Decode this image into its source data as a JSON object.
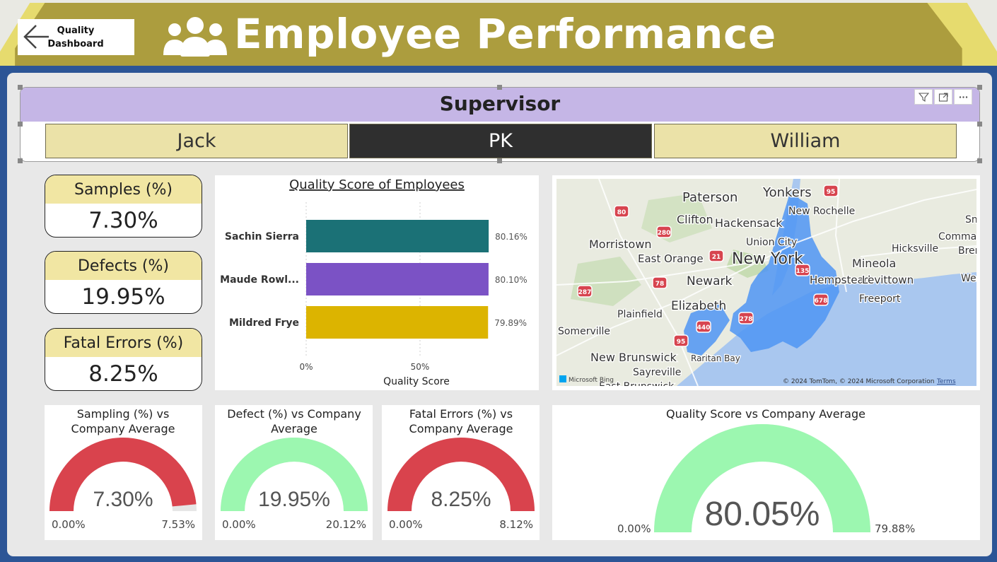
{
  "header": {
    "title": "Employee Performance",
    "back_button_label": "Quality Dashboard"
  },
  "slicer": {
    "title": "Supervisor",
    "options": [
      "Jack",
      "PK",
      "William"
    ],
    "selected": "PK"
  },
  "kpis": [
    {
      "label": "Samples (%)",
      "value": "7.30%"
    },
    {
      "label": "Defects (%)",
      "value": "19.95%"
    },
    {
      "label": "Fatal Errors (%)",
      "value": "8.25%"
    }
  ],
  "bar_chart": {
    "title": "Quality Score of Employees",
    "x_axis_title": "Quality Score",
    "x_ticks": [
      "0%",
      "50%"
    ],
    "bars": [
      {
        "label": "Sachin Sierra",
        "value": 80.16,
        "display": "80.16%",
        "color": "#1b7176"
      },
      {
        "label": "Maude Rowl...",
        "value": 80.1,
        "display": "80.10%",
        "color": "#7b52c5"
      },
      {
        "label": "Mildred Frye",
        "value": 79.89,
        "display": "79.89%",
        "color": "#dcb400"
      }
    ]
  },
  "map": {
    "labels": [
      "Paterson",
      "Yonkers",
      "New Rochelle",
      "Clifton",
      "Hackensack",
      "Morristown",
      "Union City",
      "East Orange",
      "New York",
      "Hicksville",
      "Mineola",
      "Newark",
      "Hempstead",
      "Levittown",
      "Elizabeth",
      "Freeport",
      "Plainfield",
      "Somerville",
      "New Brunswick",
      "Sayreville",
      "Raritan Bay",
      "East Brunswick",
      "Smi",
      "Comma",
      "Brent",
      "West"
    ],
    "shields": [
      "95",
      "80",
      "280",
      "21",
      "78",
      "287",
      "440",
      "95",
      "135",
      "278",
      "678"
    ],
    "attribution": "© 2024 TomTom, © 2024 Microsoft Corporation",
    "terms": "Terms",
    "bing": "Microsoft Bing",
    "colors": {
      "land": "#e9ebe0",
      "water": "#a9c7ef",
      "highlight": "#4f95f3"
    }
  },
  "gauges": [
    {
      "title": "Sampling (%) vs Company Average",
      "value": "7.30%",
      "min": "0.00%",
      "max": "7.53%",
      "fill": 0.97,
      "color": "#d9434d"
    },
    {
      "title": "Defect (%) vs Company Average",
      "value": "19.95%",
      "min": "0.00%",
      "max": "20.12%",
      "fill": 1.0,
      "color": "#9cf7b0"
    },
    {
      "title": "Fatal Errors (%) vs Company Average",
      "value": "8.25%",
      "min": "0.00%",
      "max": "8.12%",
      "fill": 1.0,
      "color": "#d9434d"
    },
    {
      "title": "Quality Score vs Company Average",
      "value": "80.05%",
      "min": "0.00%",
      "max": "79.88%",
      "fill": 1.0,
      "color": "#9cf7b0"
    }
  ]
}
